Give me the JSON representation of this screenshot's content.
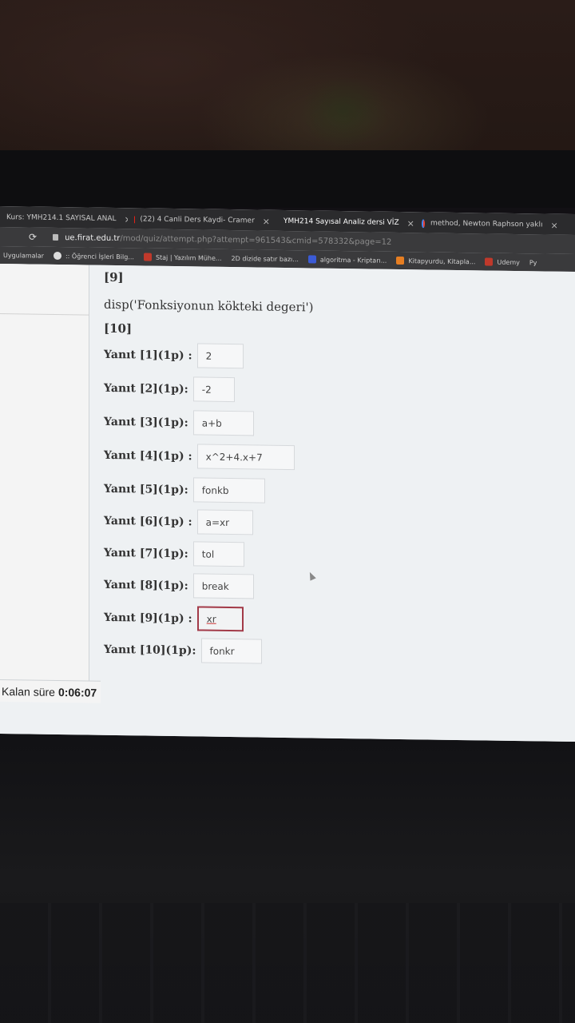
{
  "browser": {
    "tabs": [
      {
        "label": "Kurs: YMH214.1 SAYISAL ANAL",
        "active": false
      },
      {
        "label": "(22) 4 Canli Ders Kaydi- Cramer",
        "active": false
      },
      {
        "label": "YMH214 Sayısal Analiz dersi VİZ",
        "active": true
      },
      {
        "label": "method, Newton Raphson yaklı",
        "active": false
      }
    ],
    "url_host": "ue.firat.edu.tr",
    "url_path": "/mod/quiz/attempt.php?attempt=961543&cmid=578332&page=12",
    "bookmarks": [
      "Uygulamalar",
      ":: Öğrenci İşleri Bilg...",
      "Staj | Yazılım Mühe...",
      "2D dizide satır bazı...",
      "algoritma - Kriptarı...",
      "Kitapyurdu, Kitapla...",
      "Udemy",
      "Py"
    ]
  },
  "quiz": {
    "lines": [
      "[9]",
      "disp('Fonksiyonun kökteki degeri')",
      "[10]"
    ],
    "answers": [
      {
        "label": "Yanıt [1](1p) :",
        "value": "2"
      },
      {
        "label": "Yanıt [2](1p):",
        "value": "-2"
      },
      {
        "label": "Yanıt [3](1p):",
        "value": "a+b"
      },
      {
        "label": "Yanıt [4](1p) :",
        "value": "x^2+4.x+7"
      },
      {
        "label": "Yanıt [5](1p):",
        "value": "fonkb"
      },
      {
        "label": "Yanıt [6](1p) :",
        "value": "a=xr"
      },
      {
        "label": "Yanıt [7](1p):",
        "value": "tol"
      },
      {
        "label": "Yanıt [8](1p):",
        "value": "break"
      },
      {
        "label": "Yanıt [9](1p) :",
        "value": "xr"
      },
      {
        "label": "Yanıt [10](1p):",
        "value": "fonkr"
      }
    ]
  },
  "timer": {
    "label": "Kalan süre",
    "value": "0:06:07"
  }
}
